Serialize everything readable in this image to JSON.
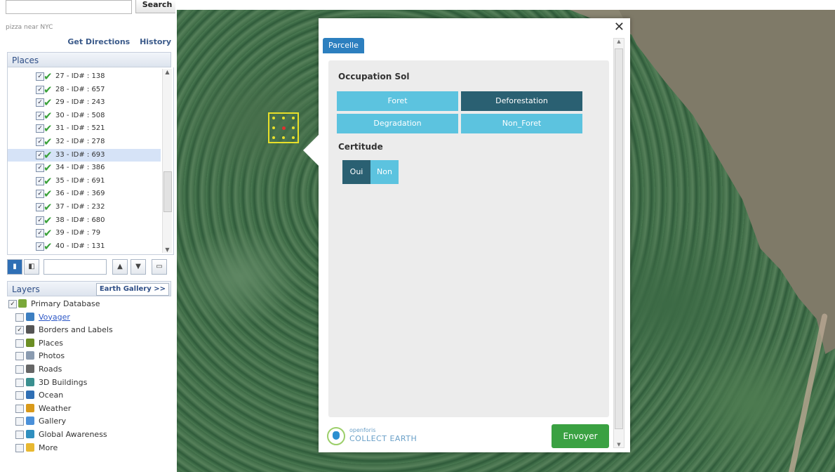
{
  "search": {
    "button_label": "Search",
    "hint": "pizza near NYC"
  },
  "links": {
    "get_directions": "Get Directions",
    "history": "History"
  },
  "places": {
    "header": "Places",
    "items": [
      {
        "label": "27 - ID# : 138",
        "selected": false
      },
      {
        "label": "28 - ID# : 657",
        "selected": false
      },
      {
        "label": "29 - ID# : 243",
        "selected": false
      },
      {
        "label": "30 - ID# : 508",
        "selected": false
      },
      {
        "label": "31 - ID# : 521",
        "selected": false
      },
      {
        "label": "32 - ID# : 278",
        "selected": false
      },
      {
        "label": "33 - ID# : 693",
        "selected": true
      },
      {
        "label": "34 - ID# : 386",
        "selected": false
      },
      {
        "label": "35 - ID# : 691",
        "selected": false
      },
      {
        "label": "36 - ID# : 369",
        "selected": false
      },
      {
        "label": "37 - ID# : 232",
        "selected": false
      },
      {
        "label": "38 - ID# : 680",
        "selected": false
      },
      {
        "label": "39 - ID# : 79",
        "selected": false
      },
      {
        "label": "40 - ID# : 131",
        "selected": false
      }
    ]
  },
  "layers": {
    "header": "Layers",
    "earth_gallery": "Earth Gallery >>",
    "items": [
      {
        "label": "Primary Database",
        "checked": true,
        "icon": "database-icon",
        "color": "#7aa83a"
      },
      {
        "label": "Voyager",
        "checked": false,
        "icon": "voyager-icon",
        "color": "#3d7fc1",
        "link": true
      },
      {
        "label": "Borders and Labels",
        "checked": true,
        "icon": "flag-icon",
        "color": "#555555"
      },
      {
        "label": "Places",
        "checked": false,
        "icon": "places-icon",
        "color": "#6b8e23"
      },
      {
        "label": "Photos",
        "checked": false,
        "icon": "photos-icon",
        "color": "#8a9bb0"
      },
      {
        "label": "Roads",
        "checked": false,
        "icon": "roads-icon",
        "color": "#666666"
      },
      {
        "label": "3D Buildings",
        "checked": false,
        "icon": "buildings-icon",
        "color": "#3a8f8f"
      },
      {
        "label": "Ocean",
        "checked": false,
        "icon": "ocean-icon",
        "color": "#2f6fb5"
      },
      {
        "label": "Weather",
        "checked": false,
        "icon": "weather-icon",
        "color": "#d99a1a"
      },
      {
        "label": "Gallery",
        "checked": false,
        "icon": "gallery-icon",
        "color": "#4a90d9"
      },
      {
        "label": "Global Awareness",
        "checked": false,
        "icon": "globe-icon",
        "color": "#2f8fbf"
      },
      {
        "label": "More",
        "checked": false,
        "icon": "folder-icon",
        "color": "#e8b830"
      }
    ]
  },
  "dialog": {
    "tab": "Parcelle",
    "occupation_label": "Occupation Sol",
    "occupation_options": [
      {
        "label": "Foret",
        "selected": false
      },
      {
        "label": "Deforestation",
        "selected": true
      },
      {
        "label": "Degradation",
        "selected": false
      },
      {
        "label": "Non_Foret",
        "selected": false
      }
    ],
    "certitude_label": "Certitude",
    "certitude_options": [
      {
        "label": "Oui",
        "selected": true
      },
      {
        "label": "Non",
        "selected": false
      }
    ],
    "logo_top": "openforis",
    "logo_bottom": "COLLECT EARTH",
    "send_label": "Envoyer",
    "close_glyph": "✕"
  },
  "colors": {
    "selected_option": "#2a6072",
    "option": "#5cc3df",
    "send": "#3aa142",
    "tab": "#2c7fbf"
  }
}
